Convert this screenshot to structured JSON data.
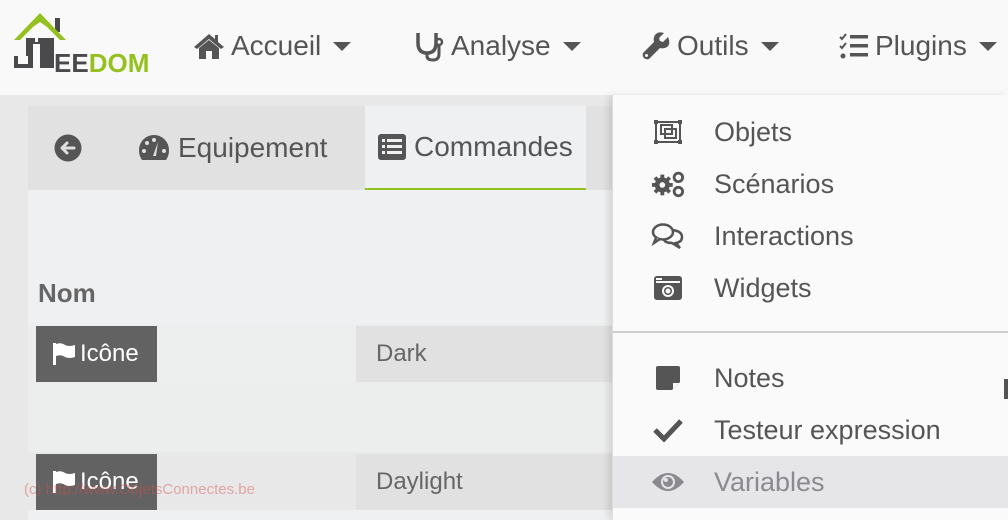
{
  "app": {
    "logo": {
      "prefix": "J",
      "part1": "EE",
      "part2": "DOM",
      "brand_color": "#94c11f"
    }
  },
  "navbar": {
    "items": [
      {
        "label": "Accueil",
        "icon": "home-icon"
      },
      {
        "label": "Analyse",
        "icon": "stethoscope-icon"
      },
      {
        "label": "Outils",
        "icon": "wrench-icon"
      },
      {
        "label": "Plugins",
        "icon": "tasks-icon"
      }
    ]
  },
  "tabs": {
    "back_icon": "arrow-circle-left-icon",
    "items": [
      {
        "label": "Equipement",
        "icon": "dashboard-icon",
        "active": false
      },
      {
        "label": "Commandes",
        "icon": "list-alt-icon",
        "active": true
      }
    ],
    "active_color": "#94c11f"
  },
  "table": {
    "header": "Nom",
    "rows": [
      {
        "icon_button": "Icône",
        "name": "Dark"
      },
      {
        "icon_button": "Icône",
        "name": "Daylight"
      }
    ]
  },
  "dropdown": {
    "group1": [
      {
        "label": "Objets",
        "icon": "objects-icon"
      },
      {
        "label": "Scénarios",
        "icon": "cogs-icon"
      },
      {
        "label": "Interactions",
        "icon": "comments-icon"
      },
      {
        "label": "Widgets",
        "icon": "camera-retro-icon"
      }
    ],
    "group2": [
      {
        "label": "Notes",
        "icon": "sticky-note-icon"
      },
      {
        "label": "Testeur expression",
        "icon": "check-icon"
      },
      {
        "label": "Variables",
        "icon": "eye-icon",
        "active": true
      }
    ]
  },
  "watermark": "(c) http://www.ObjetsConnectes.be"
}
